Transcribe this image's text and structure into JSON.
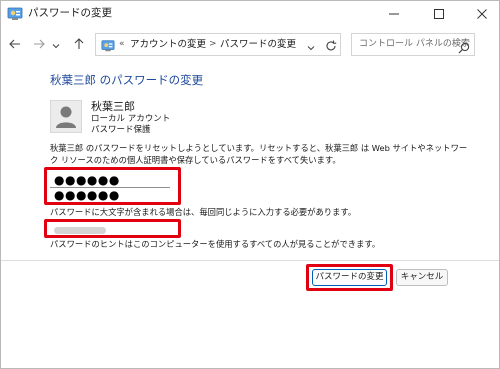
{
  "window": {
    "title": "パスワードの変更",
    "minimize_icon": "minimize-icon",
    "maximize_icon": "maximize-icon",
    "close_icon": "close-icon"
  },
  "nav": {
    "back_icon": "arrow-left-icon",
    "forward_icon": "arrow-right-icon",
    "history_icon": "chevron-down-icon",
    "up_icon": "arrow-up-icon",
    "address": {
      "overflow": "«",
      "crumbs": [
        "アカウントの変更",
        "パスワードの変更"
      ],
      "separator": ">"
    },
    "refresh_icon": "refresh-icon",
    "search_placeholder": "コントロール パネルの検索"
  },
  "content": {
    "heading": "秋葉三郎 のパスワードの変更",
    "user": {
      "name": "秋葉三郎",
      "account_type": "ローカル アカウント",
      "protection": "パスワード保護"
    },
    "description": "秋葉三郎 のパスワードをリセットしようとしています。リセットすると、秋葉三郎 は Web サイトやネットワーク リソースのための個人証明書や保存しているパスワードをすべて失います。",
    "new_password": "●●●●●●",
    "confirm_password": "●●●●●●",
    "caps_note": "パスワードに大文字が含まれる場合は、毎回同じように入力する必要があります。",
    "hint_note": "パスワードのヒントはこのコンピューターを使用するすべての人が見ることができます。"
  },
  "buttons": {
    "change": "パスワードの変更",
    "cancel": "キャンセル"
  },
  "colors": {
    "heading": "#1e4a9c",
    "highlight": "#e0000f",
    "primary_border": "#005fb8"
  }
}
